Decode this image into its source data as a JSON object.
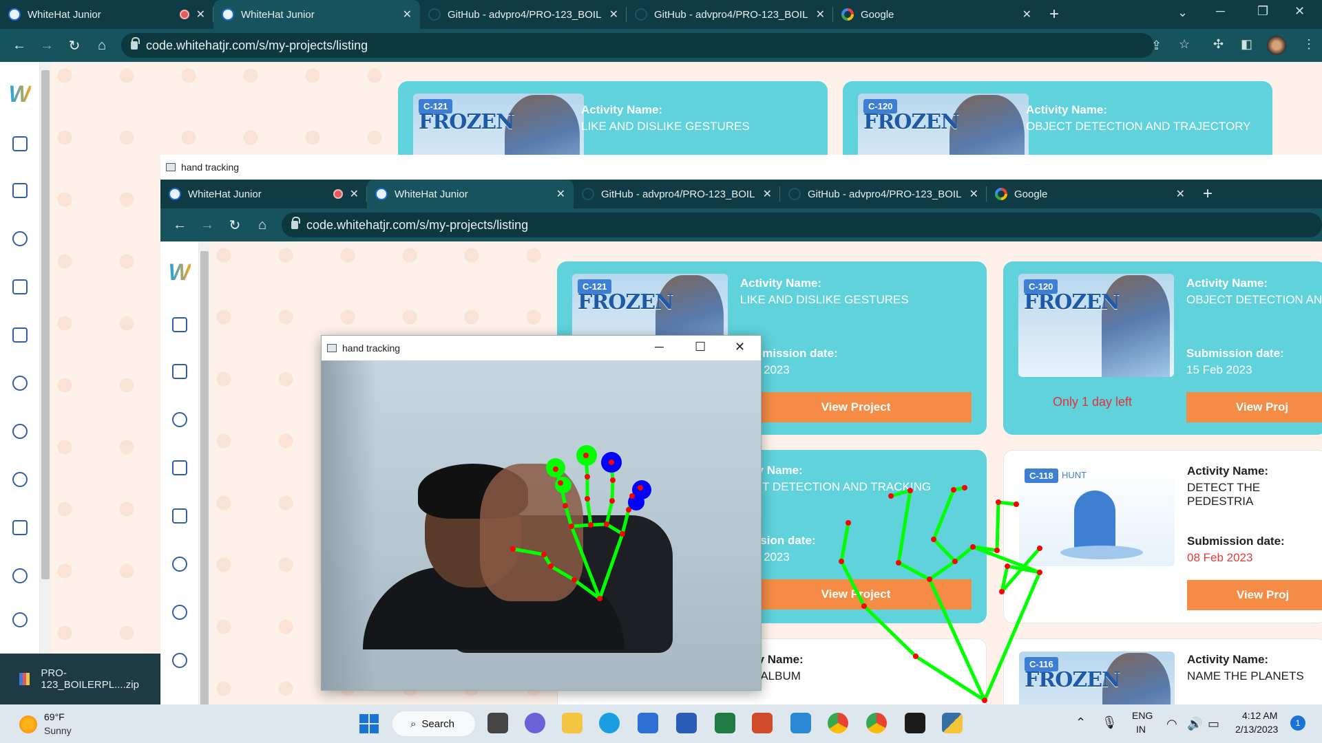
{
  "browser": {
    "tabs": [
      {
        "title": "WhiteHat Junior",
        "recording": true
      },
      {
        "title": "WhiteHat Junior",
        "active": true
      },
      {
        "title": "GitHub - advpro4/PRO-123_BOIL"
      },
      {
        "title": "GitHub - advpro4/PRO-123_BOIL"
      },
      {
        "title": "Google"
      }
    ],
    "url": "code.whitehatjr.com/s/my-projects/listing"
  },
  "cards": [
    {
      "code": "C-121",
      "thumb_title": "FROZEN",
      "activity_label": "Activity Name:",
      "activity_name": "LIKE AND DISLIKE GESTURES",
      "submission_label": "Submission date:",
      "submission_date": "Feb 2023",
      "button": "View Project"
    },
    {
      "code": "C-120",
      "thumb_title": "FROZEN",
      "activity_label": "Activity Name:",
      "activity_name": "OBJECT DETECTION AND TRAJECTORY",
      "activity_name_short": "OBJECT DETECTION AN",
      "submission_label": "Submission date:",
      "submission_date": "15 Feb 2023",
      "days_left": "Only 1 day left",
      "button": "View Proj"
    },
    {
      "activity_label": "ivity Name:",
      "activity_name": "JECT DETECTION AND TRACKING",
      "submission_label": "mission date:",
      "submission_date": "Feb 2023",
      "button": "View Project"
    },
    {
      "code": "C-118",
      "thumb_title": "HUNT",
      "activity_label": "Activity Name:",
      "activity_name": "DETECT THE PEDESTRIA",
      "submission_label": "Submission date:",
      "submission_date": "08 Feb 2023",
      "button": "View Proj"
    },
    {
      "activity_label": "ivity Name:",
      "activity_name": "EO ALBUM"
    },
    {
      "code": "C-116",
      "thumb_title": "FROZEN",
      "activity_label": "Activity Name:",
      "activity_name": "NAME THE PLANETS"
    }
  ],
  "hand_window": {
    "title": "hand tracking"
  },
  "download": {
    "file": "PRO-123_BOILERPL....zip"
  },
  "taskbar": {
    "weather_temp": "69°F",
    "weather_desc": "Sunny",
    "search": "Search",
    "lang": "ENG",
    "region": "IN",
    "time": "4:12 AM",
    "date": "2/13/2023",
    "notif_count": "1"
  },
  "colors": {
    "chrome_tab": "#0f3b44",
    "chrome_toolbar": "#17535d",
    "card_teal": "#5fd2dc",
    "button_orange": "#f48c45",
    "landmark_green": "#00ff00",
    "landmark_red": "#ff0000",
    "landmark_blue": "#0000ff"
  }
}
